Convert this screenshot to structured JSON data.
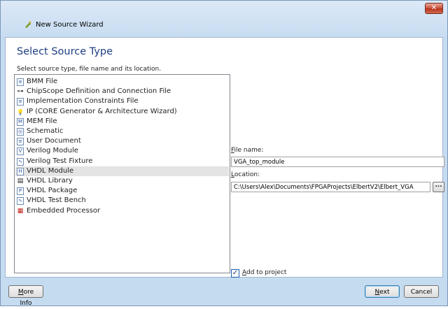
{
  "window": {
    "title": "New Source Wizard",
    "close_glyph": "✕"
  },
  "page": {
    "heading": "Select Source Type",
    "subheading": "Select source type, file name and its location."
  },
  "source_types": [
    {
      "label": "BMM File",
      "icon": "document-icon",
      "glyph": "≡"
    },
    {
      "label": "ChipScope Definition and Connection File",
      "icon": "chipscope-probe-icon",
      "glyph": "⊶"
    },
    {
      "label": "Implementation Constraints File",
      "icon": "document-icon",
      "glyph": "≡"
    },
    {
      "label": "IP (CORE Generator & Architecture Wizard)",
      "icon": "lightbulb-icon",
      "glyph": "💡"
    },
    {
      "label": "MEM File",
      "icon": "document-icon",
      "glyph": "M"
    },
    {
      "label": "Schematic",
      "icon": "schematic-icon",
      "glyph": "◎"
    },
    {
      "label": "User Document",
      "icon": "document-icon",
      "glyph": "≡"
    },
    {
      "label": "Verilog Module",
      "icon": "verilog-file-icon",
      "glyph": "V"
    },
    {
      "label": "Verilog Test Fixture",
      "icon": "verilog-test-icon",
      "glyph": "∿"
    },
    {
      "label": "VHDL Module",
      "icon": "vhdl-file-icon",
      "glyph": "H"
    },
    {
      "label": "VHDL Library",
      "icon": "vhdl-library-icon",
      "glyph": "▤"
    },
    {
      "label": "VHDL Package",
      "icon": "vhdl-package-icon",
      "glyph": "P"
    },
    {
      "label": "VHDL Test Bench",
      "icon": "vhdl-test-icon",
      "glyph": "∿"
    },
    {
      "label": "Embedded Processor",
      "icon": "processor-icon",
      "glyph": "▦"
    }
  ],
  "selected_index": 9,
  "form": {
    "file_name_label_accel": "F",
    "file_name_label_rest": "ile name:",
    "file_name_value": "VGA_top_module",
    "location_label_accel": "L",
    "location_label_rest": "ocation:",
    "location_value": "C:\\Users\\Alex\\Documents\\FPGAProjects\\ElbertV2\\Elbert_VGA",
    "browse_label": "...",
    "add_to_project_accel": "A",
    "add_to_project_rest": "dd to project",
    "add_to_project_checked": true,
    "check_glyph": "✓"
  },
  "footer": {
    "more_info_accel": "M",
    "more_info_rest": "ore Info",
    "next_accel": "N",
    "next_rest": "ext",
    "cancel_label": "Cancel"
  },
  "colors": {
    "heading": "#1e3e83",
    "window_frame": "#c5dbf0",
    "selection": "#e4e4e4"
  }
}
